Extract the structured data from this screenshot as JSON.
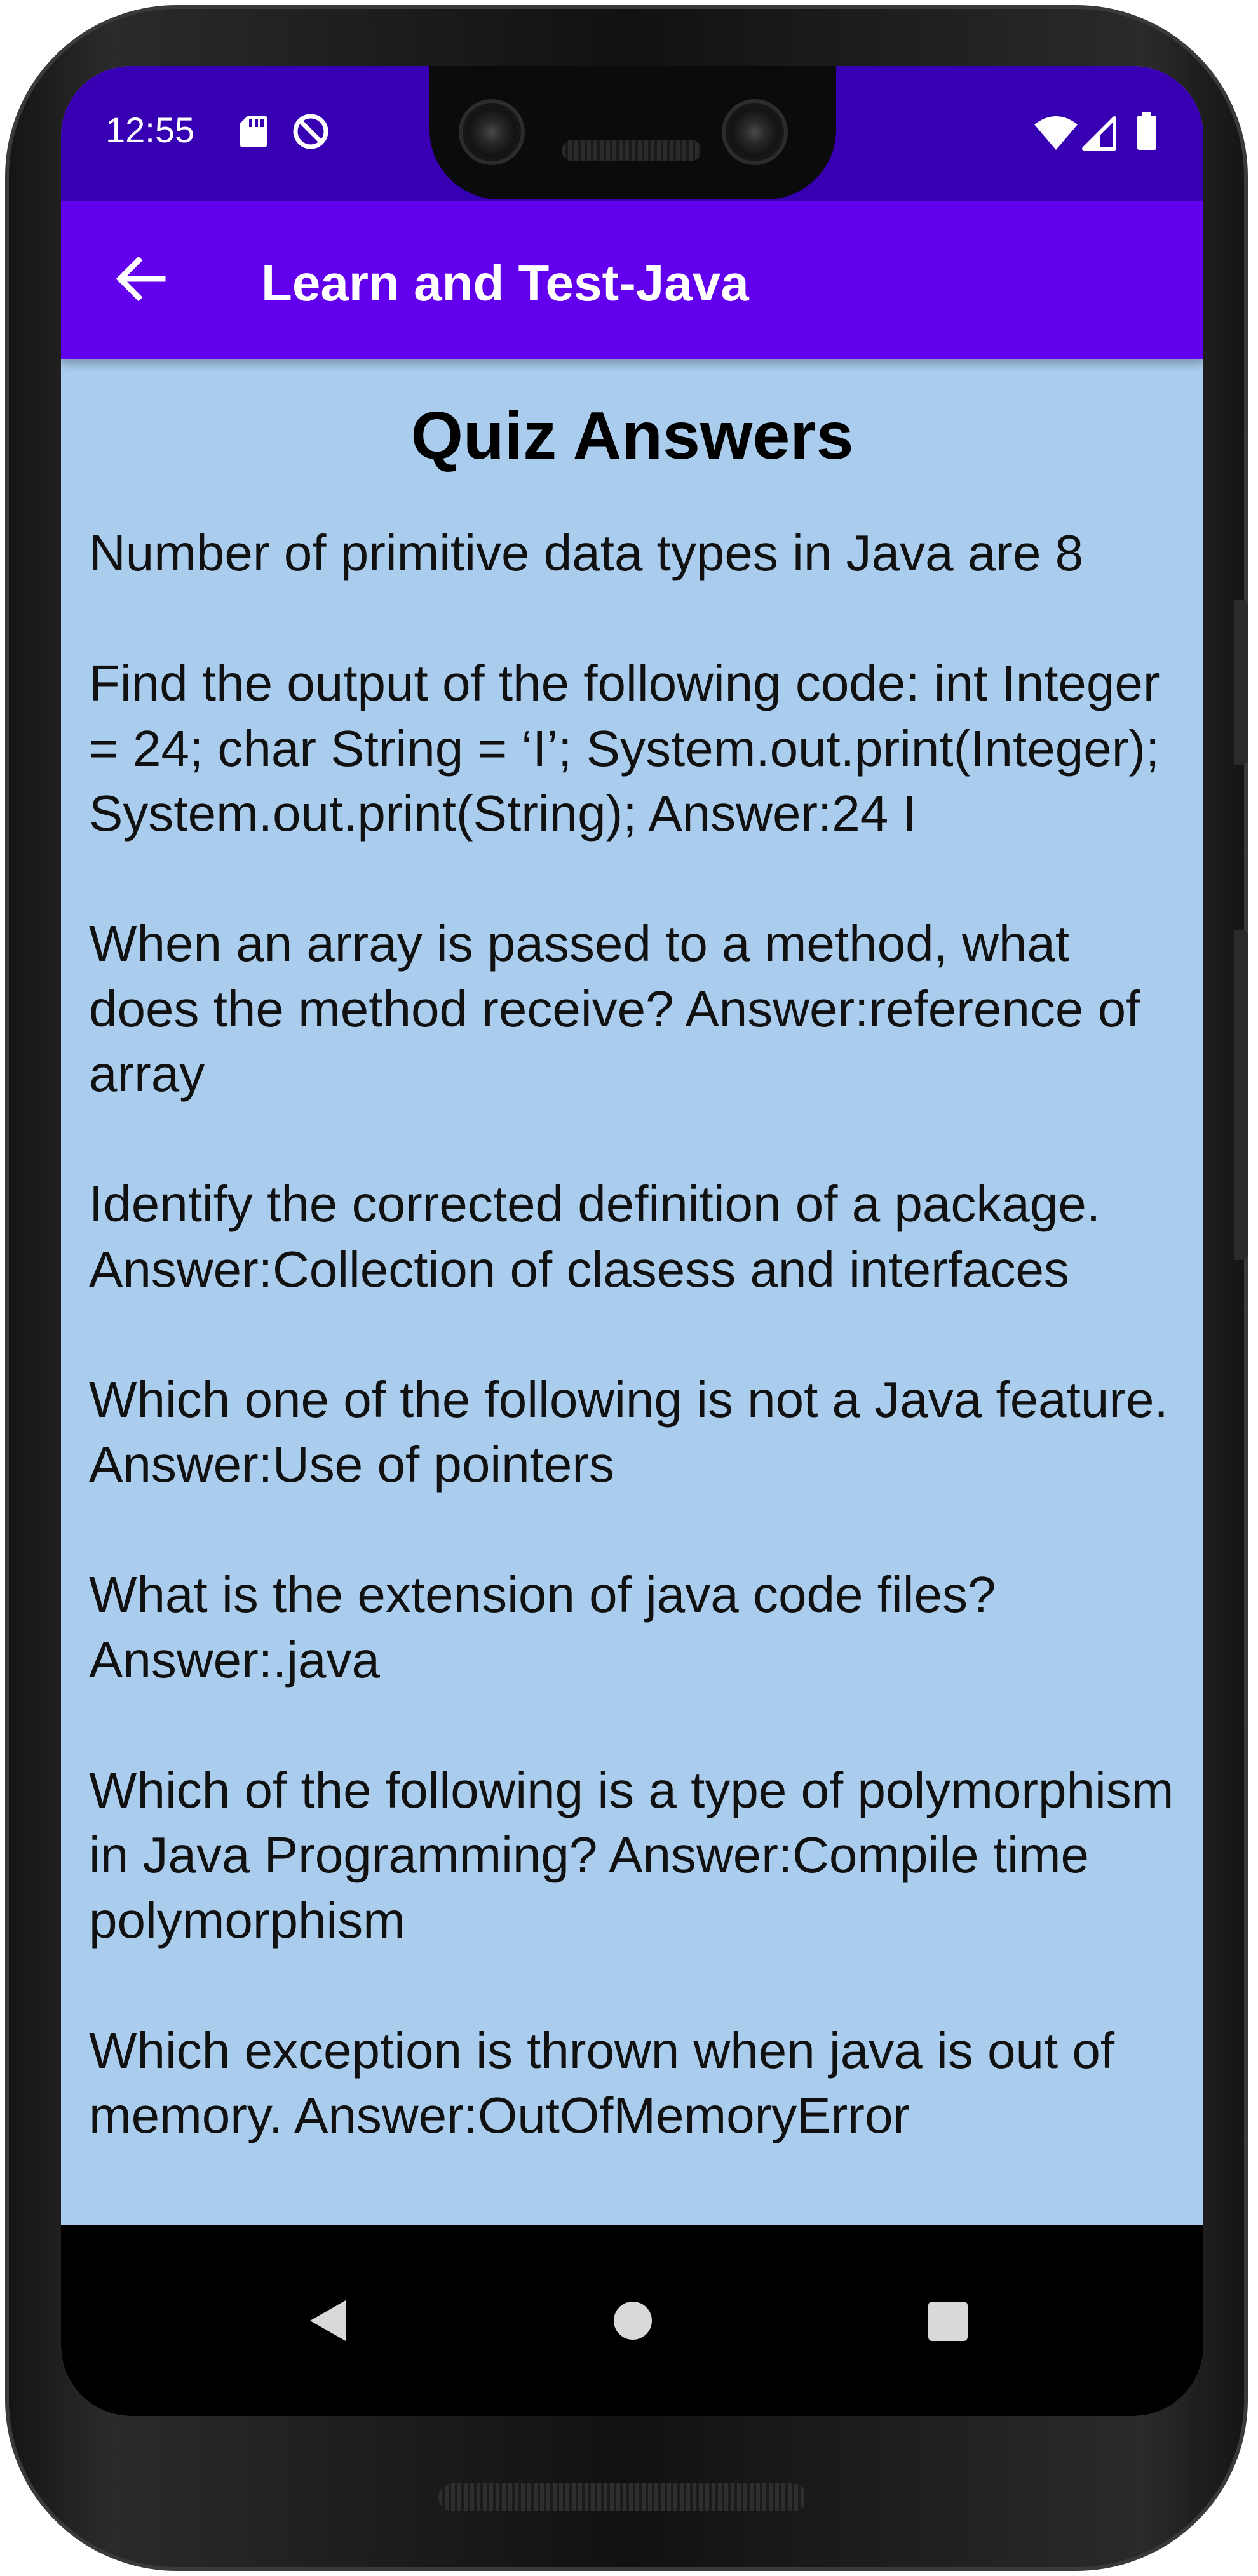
{
  "status_bar": {
    "time": "12:55",
    "left_icons": [
      "sd-card-icon",
      "data-saver-icon"
    ],
    "right_icons": [
      "wifi-icon",
      "cell-signal-icon",
      "battery-icon"
    ],
    "color": "#3700b3"
  },
  "app_bar": {
    "title": "Learn and Test-Java",
    "back_icon": "arrow-back-icon",
    "color": "#6200ee"
  },
  "content": {
    "heading": "Quiz Answers",
    "background": "#aacdee",
    "answers": [
      "Number of primitive data types in Java are 8",
      "Find the output of the following code: int Integer = 24; char String = ‘I’; System.out.print(Integer); System.out.print(String); Answer:24 I",
      "When an array is passed to a method, what does the method receive? Answer:reference of array",
      "Identify the corrected definition of a package. Answer:Collection of clasess and interfaces",
      "Which one of the following is not a Java feature. Answer:Use of pointers",
      "What is the extension of java code files? Answer:.java",
      "Which of the following is a type of polymorphism in Java Programming? Answer:Compile time polymorphism",
      "Which exception is thrown when java is out of memory. Answer:OutOfMemoryError"
    ]
  },
  "nav_bar": {
    "buttons": [
      "back-triangle-icon",
      "home-circle-icon",
      "recents-square-icon"
    ]
  }
}
